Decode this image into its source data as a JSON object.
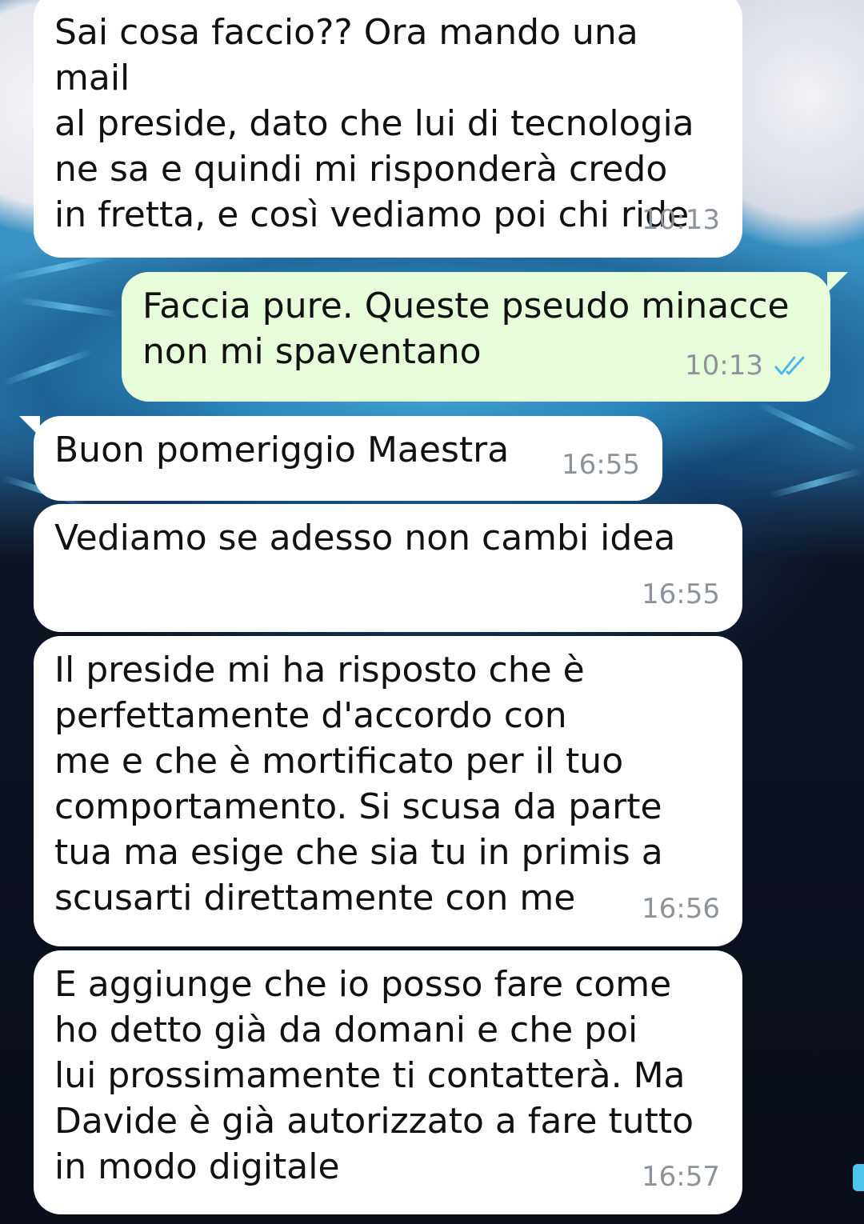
{
  "messages": [
    {
      "direction": "incoming",
      "text": "Sai cosa faccio?? Ora mando una mail\nal preside, dato che lui di tecnologia\nne sa e quindi mi risponderà credo\nin fretta, e così vediamo poi chi ride",
      "time": "10:13"
    },
    {
      "direction": "outgoing",
      "text": "Faccia pure. Queste pseudo minacce\nnon mi spaventano",
      "time": "10:13",
      "status_icon": "double-check-read-icon"
    },
    {
      "direction": "incoming",
      "text": "Buon pomeriggio Maestra",
      "time": "16:55"
    },
    {
      "direction": "incoming",
      "text": "Vediamo se adesso non cambi idea",
      "time": "16:55"
    },
    {
      "direction": "incoming",
      "text": "Il preside mi ha risposto che è\nperfettamente d'accordo con\nme e che è mortificato per il tuo\ncomportamento. Si scusa da parte\ntua ma esige che sia tu in primis a\nscusarti direttamente con me",
      "time": "16:56"
    },
    {
      "direction": "incoming",
      "text": "E aggiunge che io posso fare come\nho detto già da domani e che poi\nlui prossimamente ti contatterà. Ma\nDavide è già autorizzato a fare tutto\nin modo digitale",
      "time": "16:57"
    }
  ],
  "colors": {
    "incoming_bubble": "#ffffff",
    "outgoing_bubble": "#e7fcd8",
    "timestamp": "#8c939a",
    "read_check": "#4fb6ec"
  }
}
